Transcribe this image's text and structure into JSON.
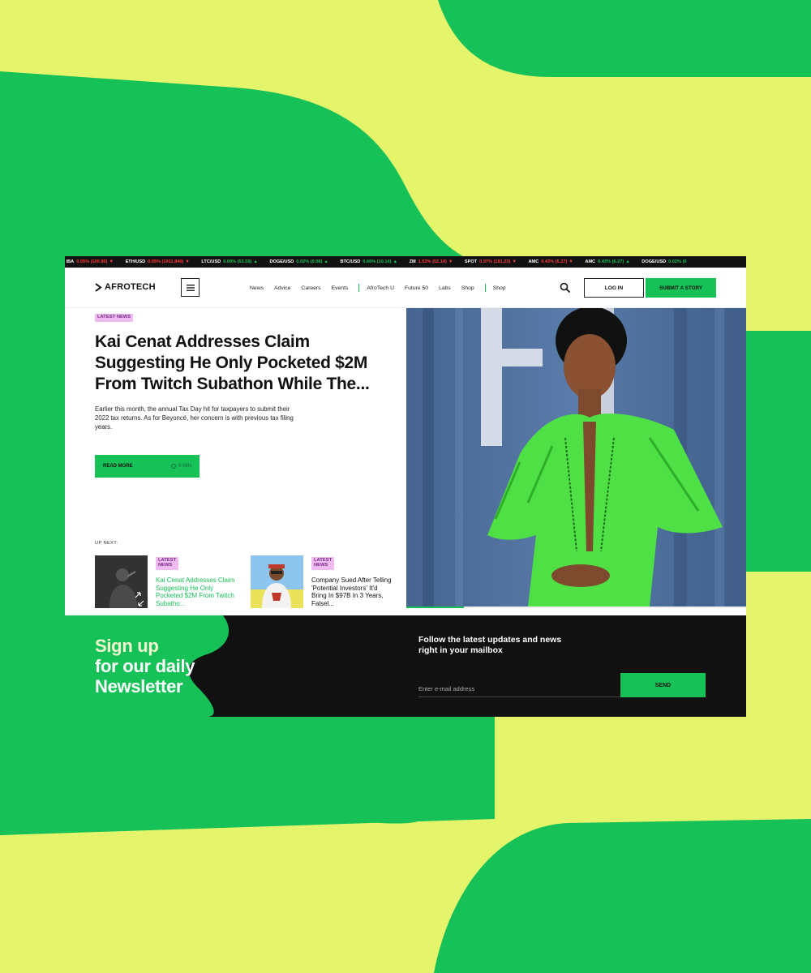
{
  "colors": {
    "lime_bg": "#e4f56c",
    "brand_green": "#16c158",
    "dark": "#111111",
    "badge_pink": "#eebcf0"
  },
  "ticker": [
    {
      "symbol": "IBA",
      "change": "0.05% (100.90)",
      "direction": "down"
    },
    {
      "symbol": "ETH/USD",
      "change": "0.05% (1911.840)",
      "direction": "down"
    },
    {
      "symbol": "LTC/USD",
      "change": "0.09% (53.55)",
      "direction": "up"
    },
    {
      "symbol": "DOGE/USD",
      "change": "0.02% (0.08)",
      "direction": "up"
    },
    {
      "symbol": "BTC/USD",
      "change": "0.60% (10.14)",
      "direction": "up"
    },
    {
      "symbol": "ZM",
      "change": "1.53% (52.14)",
      "direction": "down"
    },
    {
      "symbol": "SPOT",
      "change": "0.97% (181.23)",
      "direction": "down"
    },
    {
      "symbol": "AMC",
      "change": "0.43% (6.27)",
      "direction": "down"
    },
    {
      "symbol": "AMC",
      "change": "0.43% (6.27)",
      "direction": "up"
    },
    {
      "symbol": "DOGE/USD",
      "change": "0.02% (0",
      "direction": "up"
    }
  ],
  "nav": {
    "logo": "AFROTECH",
    "menu_icon": "hamburger-icon",
    "links_group1": [
      "News",
      "Advice",
      "Careers",
      "Events"
    ],
    "links_group2": [
      "AfroTech U",
      "Future 50",
      "Labs",
      "Shop"
    ],
    "links_group3": [
      "Shop"
    ],
    "search_icon": "search-icon",
    "login": "LOG IN",
    "submit": "SUBMIT A STORY"
  },
  "hero": {
    "badge": "LATEST NEWS",
    "headline": "Kai Cenat Addresses Claim Suggesting He Only Pocketed $2M From Twitch Subathon While The...",
    "excerpt": "Earlier this month, the annual Tax Day hit for taxpayers to submit their 2022 tax returns. As for Beyoncé, her concern is with previous tax filing years.",
    "read_more": "READ MORE",
    "read_time": "6 MIN",
    "slide_progress": 0.17
  },
  "up_next": {
    "label": "UP NEXT:",
    "cards": [
      {
        "badge": "LATEST NEWS",
        "title": "Kai Cenat Addresses Claim Suggesting He Only Pocketed $2M From Twitch Subatho..."
      },
      {
        "badge": "LATEST NEWS",
        "title": "Company Sued After Telling 'Potential Investors' It'd Bring In $97B In 3 Years, Falsel..."
      }
    ]
  },
  "newsletter": {
    "line1": "Sign up",
    "line2": "for our daily",
    "line3": "Newsletter",
    "subtext": "Follow the latest updates and news right in your mailbox",
    "placeholder": "Enter e-mail address",
    "send": "SEND"
  }
}
